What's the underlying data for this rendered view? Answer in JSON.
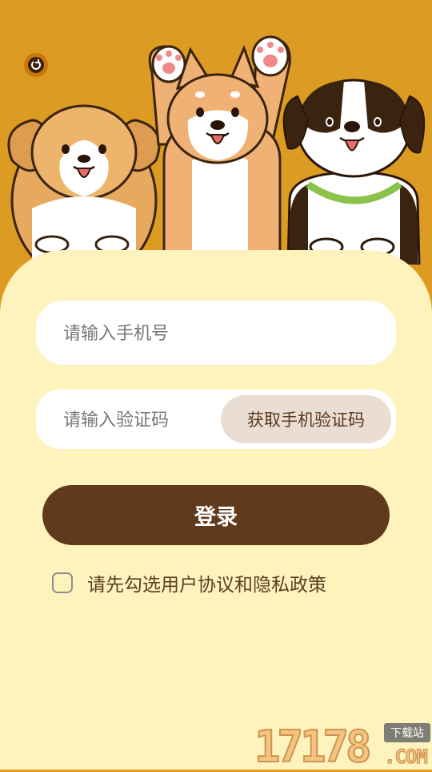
{
  "hero": {
    "background_color": "#DC9B22",
    "illustration": "three-cartoon-dogs"
  },
  "back_button": {
    "icon": "refresh-icon"
  },
  "form": {
    "phone_placeholder": "请输入手机号",
    "code_placeholder": "请输入验证码",
    "get_code_label": "获取手机验证码",
    "login_label": "登录",
    "agreement_label": "请先勾选用户协议和隐私政策",
    "agreement_checked": false
  },
  "watermark": {
    "digits": "17178",
    "badge": "下载站",
    "suffix": ".COM"
  },
  "colors": {
    "card_background": "#FEF3BC",
    "login_button": "#613A1C",
    "get_code_button": "#EADDD3"
  }
}
